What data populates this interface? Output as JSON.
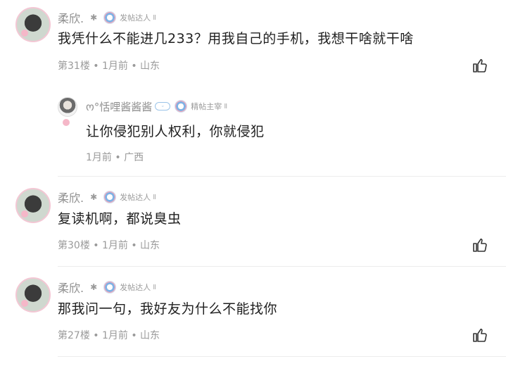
{
  "comments": [
    {
      "user": "柔欣.",
      "badge": "发帖达人",
      "level": "Ⅱ",
      "text": "我凭什么不能进几233？用我自己的手机，我想干啥就干啥",
      "meta": "第31楼 • 1月前 • 山东"
    },
    {
      "user": "柔欣.",
      "badge": "发帖达人",
      "level": "Ⅱ",
      "text": "复读机啊，都说臭虫",
      "meta": "第30楼 • 1月前 • 山东"
    },
    {
      "user": "柔欣.",
      "badge": "发帖达人",
      "level": "Ⅱ",
      "text": "那我问一句，我好友为什么不能找你",
      "meta": "第27楼 • 1月前 • 山东"
    }
  ],
  "reply": {
    "user": "ო°恬哩酱酱酱",
    "badge": "精帖主宰",
    "level": "Ⅱ",
    "text": "让你侵犯别人权利，你就侵犯",
    "meta": "1月前 • 广西"
  },
  "icons": {
    "like": "thumbs-up-icon",
    "spider": "spider-icon",
    "badge": "badge-icon"
  }
}
